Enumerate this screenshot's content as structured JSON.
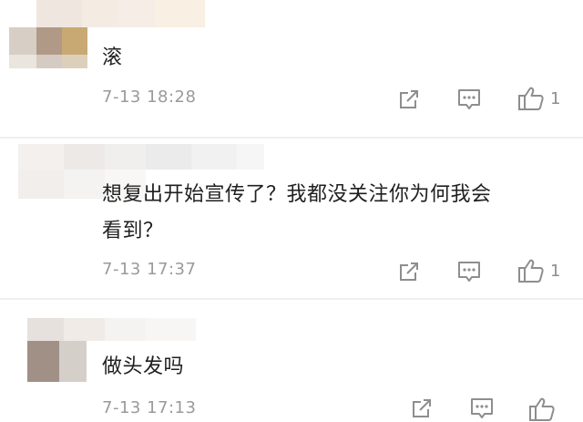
{
  "comments": [
    {
      "text": "滚",
      "time": "7-13 18:28",
      "likes": "1",
      "icons": [
        "share-icon",
        "comment-icon",
        "thumbs-up-icon"
      ]
    },
    {
      "text": "想复出开始宣传了？我都没关注你为何我会",
      "text_line2": "看到？",
      "time": "7-13 17:37",
      "likes": "1",
      "icons": [
        "share-icon",
        "comment-icon",
        "thumbs-up-icon"
      ]
    },
    {
      "text": "做头发吗",
      "time": "7-13 17:13",
      "icons": [
        "share-icon",
        "comment-icon",
        "thumbs-up-icon"
      ]
    }
  ],
  "colors": {
    "text": "#1f1f1f",
    "meta": "#9a9a9a",
    "icon": "#8e8e8e",
    "divider": "#efefef"
  }
}
